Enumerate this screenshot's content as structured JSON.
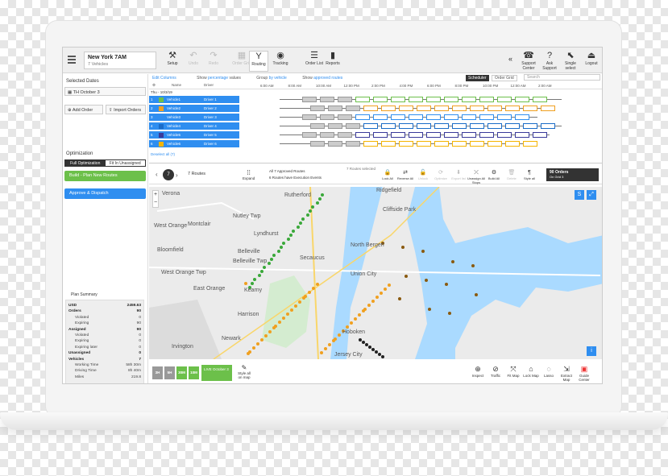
{
  "context": {
    "title": "New York 7AM",
    "subtitle": "7 Vehicles"
  },
  "toolbar": [
    {
      "label": "Setup",
      "icon": "wrench-icon",
      "glyph": "⚒"
    },
    {
      "label": "Undo",
      "icon": "undo-icon",
      "glyph": "↶",
      "disabled": true
    },
    {
      "label": "Redo",
      "icon": "redo-icon",
      "glyph": "↷",
      "disabled": true
    },
    {
      "label": "Order Grid",
      "icon": "grid-icon",
      "glyph": "▦",
      "disabled": true
    },
    {
      "label": "Routing",
      "icon": "routing-icon",
      "glyph": "Y",
      "active": true
    },
    {
      "label": "Tracking",
      "icon": "tracking-icon",
      "glyph": "◉"
    },
    {
      "label": "Order List",
      "icon": "list-icon",
      "glyph": "☰"
    },
    {
      "label": "Reports",
      "icon": "reports-icon",
      "glyph": "▮"
    }
  ],
  "toolbar_right": [
    {
      "label": "Support Center",
      "icon": "support-icon",
      "glyph": "☎"
    },
    {
      "label": "Ask Support",
      "icon": "help-icon",
      "glyph": "?"
    },
    {
      "label": "Single select",
      "icon": "pointer-icon",
      "glyph": "⬉"
    },
    {
      "label": "Logout",
      "icon": "logout-icon",
      "glyph": "⏏"
    }
  ],
  "left": {
    "selected_dates_label": "Selected Dates",
    "date_value": "TH October 3",
    "add_order": "Add Order",
    "import_orders": "Import Orders",
    "optimization_label": "Optimization",
    "full_opt": "Full Optimization",
    "fit_unassigned": "Fit In Unassigned",
    "build_plan": "Build - Plan New Routes",
    "approve_dispatch": "Approve & Dispatch",
    "plan_summary_label": "Plan Summary",
    "summary": [
      {
        "k": "USD",
        "v": "2459.63",
        "b": true
      },
      {
        "k": "Orders",
        "v": "90",
        "b": true
      },
      {
        "k": "Violated",
        "v": "0",
        "i": true
      },
      {
        "k": "Expiring",
        "v": "90",
        "i": true
      },
      {
        "k": "Assigned",
        "v": "90",
        "b": true
      },
      {
        "k": "Violated",
        "v": "0",
        "i": true
      },
      {
        "k": "Expiring",
        "v": "0",
        "i": true
      },
      {
        "k": "Expiring later",
        "v": "0",
        "i": true
      },
      {
        "k": "Unassigned",
        "v": "0",
        "b": true
      },
      {
        "k": "Vehicles",
        "v": "7",
        "b": true
      },
      {
        "k": "Working Time",
        "v": "58h 30m",
        "i": true
      },
      {
        "k": "Driving Time",
        "v": "8h 40m",
        "i": true
      },
      {
        "k": "Miles",
        "v": "219.8",
        "i": true
      }
    ]
  },
  "sched_header": {
    "edit_cols": "Edit Columns",
    "show_pct": "Show",
    "pct": "percentage",
    "values": "values",
    "group": "Group",
    "by": "by vehicle",
    "show_appr": "Show",
    "appr": "approved routes",
    "scheduler": "Scheduler",
    "order_grid": "Order Grid",
    "search": "Search"
  },
  "times": [
    "6:00 AM",
    "8:00 AM",
    "10:00 AM",
    "12:00 PM",
    "2:00 PM",
    "4:00 PM",
    "6:00 PM",
    "8:00 PM",
    "10:00 PM",
    "12:00 AM",
    "2:00 AM"
  ],
  "date_row": "Thu - 10/3/19",
  "col_name": "Name",
  "col_driver": "Driver",
  "vehicles": [
    {
      "n": "1",
      "name": "Vehicle1",
      "driver": "Driver 1",
      "color": "#6cc04a"
    },
    {
      "n": "2",
      "name": "Vehicle2",
      "driver": "Driver 2",
      "color": "#f0a020"
    },
    {
      "n": "3",
      "name": "Vehicle3",
      "driver": "Driver 3",
      "color": "#2f8ef0"
    },
    {
      "n": "4",
      "name": "Vehicle4",
      "driver": "Driver 4",
      "color": "#1b6cc8"
    },
    {
      "n": "5",
      "name": "Vehicle5",
      "driver": "Driver 5",
      "color": "#3a3a9a"
    },
    {
      "n": "6",
      "name": "Vehicle6",
      "driver": "Driver 6",
      "color": "#f5b400"
    }
  ],
  "deselect": "Deselect all (7)",
  "maptool": {
    "count": "7",
    "routes": "7 Routes",
    "expand": "Expand",
    "approved": "All 7 Approved Routes",
    "exec": "6 Routes have Execution Events",
    "routes_selected": "7 Routes selected",
    "actions": [
      "Lock All",
      "Reverse All",
      "Unlock",
      "Optimize",
      "Export list",
      "Unassign All Stops",
      "Build All",
      "Delete",
      "Style all"
    ],
    "orders": "90 Orders",
    "orders_sub": "On Grid 3"
  },
  "map_labels": [
    "Verona",
    "Rutherford",
    "Ridgefield",
    "West Orange",
    "Montclair",
    "Nutley Twp",
    "Lyndhurst",
    "Cliffside Park",
    "Bloomfield",
    "Belleville",
    "Belleville Twp",
    "North Bergen",
    "Secaucus",
    "West Orange Twp",
    "East Orange",
    "Kearny",
    "Union City",
    "Harrison",
    "Newark",
    "Hoboken",
    "Irvington",
    "Jersey City"
  ],
  "bottom": {
    "tiles": [
      "3H",
      "5H",
      "30M",
      "10M"
    ],
    "live": "LIVE October 3",
    "style_all": "Style all on map",
    "tools": [
      "Inspect",
      "Traffic",
      "Fit Map",
      "Lock Map",
      "Lasso",
      "Extract Map",
      "Guide Center"
    ]
  },
  "colors": {
    "primary": "#2f8ef0",
    "green": "#6cc04a",
    "orange": "#f0a020"
  }
}
